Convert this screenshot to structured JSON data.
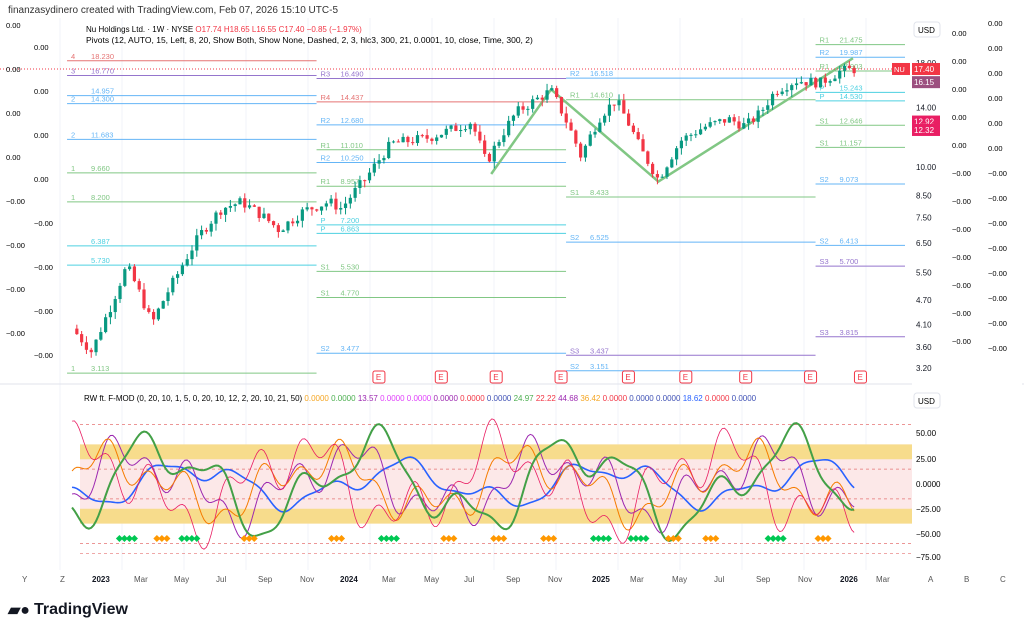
{
  "credit": "finanzasydinero created with TradingView.com, Feb 07, 2026 15:10 UTC-5",
  "legend": {
    "symbol": "Nu Holdings Ltd. · 1W · NYSE",
    "o": "O17.74",
    "h": "H18.65",
    "l": "L16.55",
    "c": "C17.40",
    "chg": "−0.85 (−1.97%)",
    "pivots": "Pivots (12, AUTO, 15, Left, 8, 20, Show Both, Show None, Dashed, 2, 3, hlc3, 300, 21, 0.0001, 10, close, Time, 300, 2)"
  },
  "osc_legend": {
    "name": "RW ft. F-MOD (0, 20, 10, 1, 5, 0, 20, 10, 12, 2, 20, 10, 21, 50)",
    "values": [
      [
        "0.0000",
        "#f5a623"
      ],
      [
        "0.0000",
        "#4caf50"
      ],
      [
        "13.57",
        "#9c27b0"
      ],
      [
        "0.0000",
        "#e040fb"
      ],
      [
        "0.0000",
        "#e040fb"
      ],
      [
        "0.0000",
        "#9c27b0"
      ],
      [
        "0.0000",
        "#f23645"
      ],
      [
        "0.0000",
        "#3f51b5"
      ],
      [
        "24.97",
        "#4caf50"
      ],
      [
        "22.22",
        "#f23645"
      ],
      [
        "44.68",
        "#9c27b0"
      ],
      [
        "36.42",
        "#f5a623"
      ],
      [
        "0.0000",
        "#f23645"
      ],
      [
        "0.0000",
        "#3f51b5"
      ],
      [
        "0.0000",
        "#3f51b5"
      ],
      [
        "18.62",
        "#2962ff"
      ],
      [
        "0.0000",
        "#f23645"
      ],
      [
        "0.0000",
        "#3f51b5"
      ]
    ]
  },
  "currency": "USD",
  "price_ticks": [
    "18.00",
    "14.00",
    "10.00",
    "8.50",
    "7.50",
    "6.50",
    "5.50",
    "4.70",
    "4.10",
    "3.60",
    "3.20"
  ],
  "price_tags": [
    {
      "label": "NU",
      "value": "17.40",
      "color": "#f23645"
    },
    {
      "value": "16.15",
      "color": "#9c4f7f"
    },
    {
      "value": "12.92",
      "color": "#e91e63"
    },
    {
      "value": "12.32",
      "color": "#e91e63"
    }
  ],
  "left_scale": [
    "0.00",
    "0.00",
    "0.00",
    "0.00",
    "0.00",
    "0.00",
    "0.00",
    "0.00",
    "−0.00",
    "−0.00",
    "−0.00",
    "−0.00",
    "−0.00",
    "−0.00",
    "−0.00",
    "−0.00"
  ],
  "right_scale_a": [
    "0.00",
    "0.00",
    "0.00",
    "0.00",
    "0.00",
    "−0.00",
    "−0.00",
    "−0.00",
    "−0.00",
    "−0.00",
    "−0.00",
    "−0.00"
  ],
  "right_scale_b": [
    "0.00",
    "0.00",
    "0.00",
    "0.00",
    "0.00",
    "0.00",
    "−0.00",
    "−0.00",
    "−0.00",
    "−0.00",
    "−0.00",
    "−0.00",
    "−0.00",
    "−0.00"
  ],
  "osc_ticks": [
    "50.00",
    "25.00",
    "0.0000",
    "−25.00",
    "−50.00",
    "−75.00"
  ],
  "osc_currency": "USD",
  "time_labels": [
    "Y",
    "Z",
    "2023",
    "Mar",
    "May",
    "Jul",
    "Sep",
    "Nov",
    "2024",
    "Mar",
    "May",
    "Jul",
    "Sep",
    "Nov",
    "2025",
    "Mar",
    "May",
    "Jul",
    "Sep",
    "Nov",
    "2026",
    "Mar",
    "A",
    "B",
    "C"
  ],
  "brand": "TradingView",
  "chart_data": {
    "type": "candlestick",
    "title": "Nu Holdings Ltd. · 1W · NYSE",
    "yscale": "log",
    "ylim": [
      3.0,
      20.0
    ],
    "xlim": [
      2022.9,
      2026.3
    ],
    "price_path": [
      [
        2022.92,
        4.0
      ],
      [
        2023.0,
        3.5
      ],
      [
        2023.08,
        4.6
      ],
      [
        2023.14,
        5.7
      ],
      [
        2023.24,
        4.1
      ],
      [
        2023.34,
        5.4
      ],
      [
        2023.44,
        6.9
      ],
      [
        2023.52,
        7.9
      ],
      [
        2023.6,
        8.2
      ],
      [
        2023.68,
        7.6
      ],
      [
        2023.75,
        7.0
      ],
      [
        2023.85,
        7.8
      ],
      [
        2023.95,
        8.2
      ],
      [
        2024.0,
        7.9
      ],
      [
        2024.1,
        9.4
      ],
      [
        2024.2,
        11.4
      ],
      [
        2024.35,
        11.8
      ],
      [
        2024.45,
        12.4
      ],
      [
        2024.52,
        12.9
      ],
      [
        2024.58,
        10.2
      ],
      [
        2024.7,
        13.6
      ],
      [
        2024.84,
        15.4
      ],
      [
        2024.9,
        13.0
      ],
      [
        2024.96,
        10.6
      ],
      [
        2025.04,
        13.4
      ],
      [
        2025.1,
        14.6
      ],
      [
        2025.2,
        11.0
      ],
      [
        2025.27,
        9.3
      ],
      [
        2025.36,
        11.6
      ],
      [
        2025.45,
        12.5
      ],
      [
        2025.55,
        13.1
      ],
      [
        2025.62,
        12.6
      ],
      [
        2025.68,
        13.6
      ],
      [
        2025.74,
        15.4
      ],
      [
        2025.82,
        16.3
      ],
      [
        2025.92,
        16.1
      ],
      [
        2026.0,
        17.2
      ],
      [
        2026.06,
        17.4
      ]
    ],
    "pivot_levels": [
      {
        "label": "R1",
        "price": 19.98,
        "from": 2025.9,
        "to": 2026.35,
        "color": "#81c784",
        "text": "21.475"
      },
      {
        "label": "R2",
        "price": 18.6,
        "from": 2025.9,
        "to": 2026.35,
        "color": "#64b5f6",
        "text": "19.987"
      },
      {
        "label": "R1",
        "price": 17.2,
        "from": 2025.9,
        "to": 2026.35,
        "color": "#81c784",
        "text": "17.903"
      },
      {
        "label": "P",
        "price": 15.24,
        "from": 2025.9,
        "to": 2026.35,
        "color": "#4dd0e1",
        "text": "15.243"
      },
      {
        "label": "P",
        "price": 14.53,
        "from": 2025.9,
        "to": 2026.35,
        "color": "#4dd0e1",
        "text": "14.530"
      },
      {
        "label": "S1",
        "price": 12.65,
        "from": 2025.9,
        "to": 2026.35,
        "color": "#81c784",
        "text": "12.646"
      },
      {
        "label": "S1",
        "price": 11.16,
        "from": 2025.9,
        "to": 2026.35,
        "color": "#81c784",
        "text": "11.157"
      },
      {
        "label": "S2",
        "price": 9.07,
        "from": 2025.9,
        "to": 2026.35,
        "color": "#64b5f6",
        "text": "9.073"
      },
      {
        "label": "S2",
        "price": 6.41,
        "from": 2025.9,
        "to": 2026.35,
        "color": "#64b5f6",
        "text": "6.413"
      },
      {
        "label": "S3",
        "price": 5.7,
        "from": 2025.9,
        "to": 2026.35,
        "color": "#9575cd",
        "text": "5.700"
      },
      {
        "label": "S3",
        "price": 3.82,
        "from": 2025.9,
        "to": 2026.35,
        "color": "#9575cd",
        "text": "3.815"
      },
      {
        "label": "R2",
        "price": 16.52,
        "from": 2024.9,
        "to": 2025.9,
        "color": "#64b5f6",
        "text": "16.518"
      },
      {
        "label": "R1",
        "price": 14.62,
        "from": 2024.9,
        "to": 2025.9,
        "color": "#81c784",
        "text": "14.610"
      },
      {
        "label": "S1",
        "price": 8.43,
        "from": 2024.9,
        "to": 2025.9,
        "color": "#81c784",
        "text": "8.433"
      },
      {
        "label": "S2",
        "price": 6.53,
        "from": 2024.9,
        "to": 2025.9,
        "color": "#64b5f6",
        "text": "6.525"
      },
      {
        "label": "S3",
        "price": 3.44,
        "from": 2024.9,
        "to": 2025.9,
        "color": "#9575cd",
        "text": "3.437"
      },
      {
        "label": "S2",
        "price": 3.15,
        "from": 2024.9,
        "to": 2025.9,
        "color": "#64b5f6",
        "text": "3.151"
      },
      {
        "label": "R3",
        "price": 16.49,
        "from": 2023.9,
        "to": 2024.9,
        "color": "#9575cd",
        "text": "16.490"
      },
      {
        "label": "R4",
        "price": 14.44,
        "from": 2023.9,
        "to": 2024.9,
        "color": "#e57373",
        "text": "14.437"
      },
      {
        "label": "R2",
        "price": 12.68,
        "from": 2023.9,
        "to": 2024.9,
        "color": "#64b5f6",
        "text": "12.680"
      },
      {
        "label": "R1",
        "price": 11.01,
        "from": 2023.9,
        "to": 2024.9,
        "color": "#81c784",
        "text": "11.010"
      },
      {
        "label": "R2",
        "price": 10.25,
        "from": 2023.9,
        "to": 2024.9,
        "color": "#64b5f6",
        "text": "10.250"
      },
      {
        "label": "R1",
        "price": 8.96,
        "from": 2023.9,
        "to": 2024.9,
        "color": "#81c784",
        "text": "8.957"
      },
      {
        "label": "P",
        "price": 7.2,
        "from": 2023.9,
        "to": 2024.9,
        "color": "#4dd0e1",
        "text": "7.200"
      },
      {
        "label": "P",
        "price": 6.86,
        "from": 2023.9,
        "to": 2024.9,
        "color": "#4dd0e1",
        "text": "6.863"
      },
      {
        "label": "S1",
        "price": 5.53,
        "from": 2023.9,
        "to": 2024.9,
        "color": "#81c784",
        "text": "5.530"
      },
      {
        "label": "S1",
        "price": 4.77,
        "from": 2023.9,
        "to": 2024.9,
        "color": "#81c784",
        "text": "4.770"
      },
      {
        "label": "S2",
        "price": 3.48,
        "from": 2023.9,
        "to": 2024.9,
        "color": "#64b5f6",
        "text": "3.477"
      },
      {
        "label": "3",
        "price": 16.77,
        "from": 2022.9,
        "to": 2023.9,
        "color": "#9575cd",
        "text": "16.770"
      },
      {
        "label": "4",
        "price": 18.23,
        "from": 2022.9,
        "to": 2023.9,
        "color": "#e57373",
        "text": "18.230"
      },
      {
        "label": "",
        "price": 14.96,
        "from": 2022.9,
        "to": 2023.9,
        "color": "#64b5f6",
        "text": "14.957"
      },
      {
        "label": "2",
        "price": 14.3,
        "from": 2022.9,
        "to": 2023.9,
        "color": "#64b5f6",
        "text": "14.300"
      },
      {
        "label": "2",
        "price": 11.68,
        "from": 2022.9,
        "to": 2023.9,
        "color": "#64b5f6",
        "text": "11.683"
      },
      {
        "label": "1",
        "price": 9.66,
        "from": 2022.9,
        "to": 2023.9,
        "color": "#81c784",
        "text": "9.660"
      },
      {
        "label": "1",
        "price": 8.2,
        "from": 2022.9,
        "to": 2023.9,
        "color": "#81c784",
        "text": "8.200"
      },
      {
        "label": "",
        "price": 6.39,
        "from": 2022.9,
        "to": 2023.9,
        "color": "#4dd0e1",
        "text": "6.387"
      },
      {
        "label": "",
        "price": 5.73,
        "from": 2022.9,
        "to": 2023.9,
        "color": "#4dd0e1",
        "text": "5.730"
      },
      {
        "label": "1",
        "price": 3.11,
        "from": 2022.9,
        "to": 2023.9,
        "color": "#81c784",
        "text": "3.113"
      }
    ],
    "zigzag": [
      [
        2024.6,
        9.6
      ],
      [
        2024.84,
        15.5
      ],
      [
        2025.27,
        9.2
      ],
      [
        2026.05,
        18.5
      ]
    ],
    "earnings_markers": [
      2024.15,
      2024.4,
      2024.62,
      2024.88,
      2025.15,
      2025.38,
      2025.62,
      2025.88,
      2026.08
    ],
    "oscillator": {
      "ylim": [
        -75,
        75
      ],
      "bands": [
        [
          25,
          40
        ],
        [
          -40,
          -25
        ]
      ],
      "green_diamonds": [
        2023.1,
        2023.35,
        2024.15,
        2025.0,
        2025.15,
        2025.7
      ],
      "orange_diamonds": [
        2023.25,
        2023.6,
        2023.95,
        2024.4,
        2024.6,
        2024.8,
        2025.3,
        2025.45,
        2025.9
      ]
    }
  }
}
